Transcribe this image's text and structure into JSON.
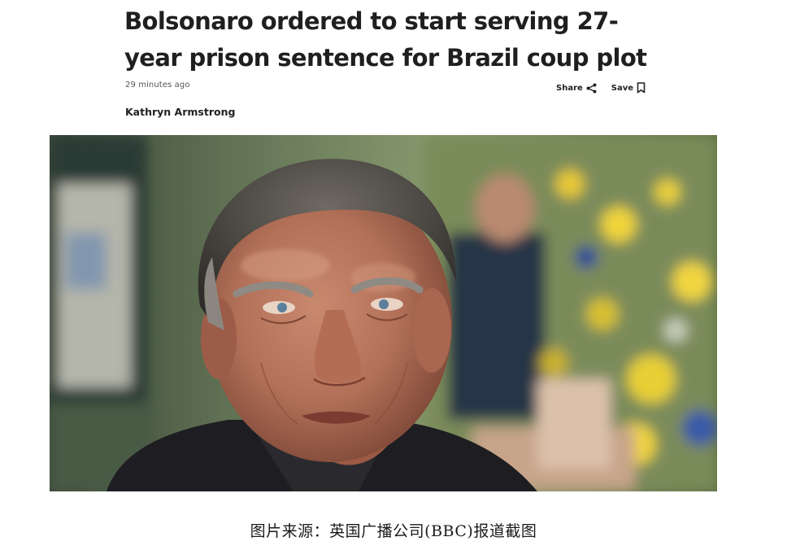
{
  "article": {
    "headline_line1": "Bolsonaro ordered to start serving 27-",
    "headline_line2": "year prison sentence for Brazil coup plot",
    "timestamp": "29 minutes ago",
    "byline": "Kathryn Armstrong"
  },
  "actions": {
    "share_label": "Share",
    "save_label": "Save",
    "share_icon": "share-icon",
    "save_icon": "bookmark-icon"
  },
  "caption": "图片来源：英国广播公司(BBC)报道截图"
}
